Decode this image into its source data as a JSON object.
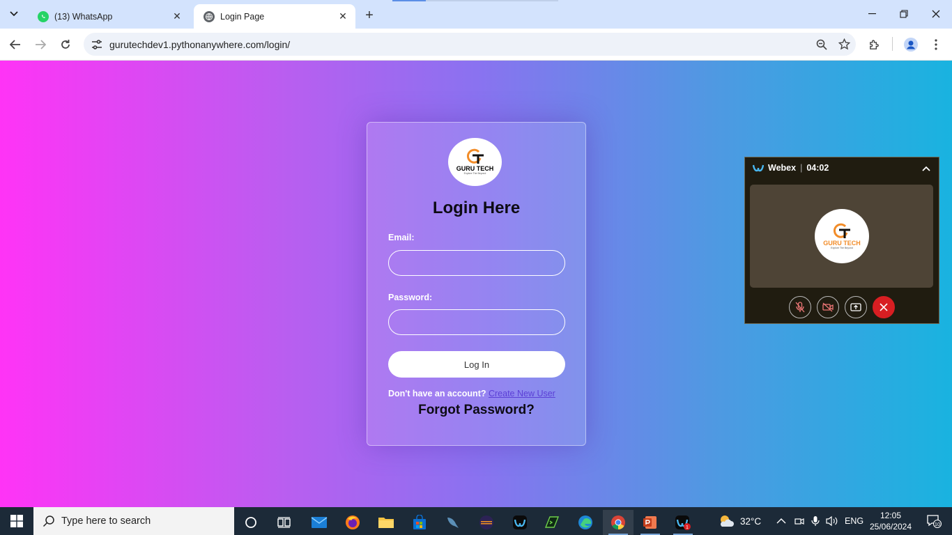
{
  "browser": {
    "tabs": [
      {
        "title": "(13) WhatsApp",
        "icon": "whatsapp-icon",
        "active": false
      },
      {
        "title": "Login Page",
        "icon": "globe-icon",
        "active": true
      }
    ],
    "url": "gurutechdev1.pythonanywhere.com/login/"
  },
  "login": {
    "logo_text": "GURU TECH",
    "logo_tagline": "Explore The Beyond",
    "title": "Login Here",
    "email_label": "Email:",
    "email_value": "",
    "password_label": "Password:",
    "password_value": "",
    "button_label": "Log In",
    "signup_prompt": "Don't have an account?",
    "signup_link": "Create New User",
    "forgot_label": "Forgot Password?"
  },
  "webex": {
    "app_name": "Webex",
    "timer": "04:02",
    "avatar_text": "GURU TECH",
    "avatar_tagline": "Explore The Beyond"
  },
  "taskbar": {
    "search_placeholder": "Type here to search",
    "weather_temp": "32°C",
    "language": "ENG",
    "time": "12:05",
    "date": "25/06/2024",
    "notification_count": "10",
    "webex_badge": "1"
  },
  "colors": {
    "gradient_left": "#ff33f6",
    "gradient_right": "#19b3e0",
    "link": "#5b3fd6",
    "end_call": "#d81e22"
  }
}
